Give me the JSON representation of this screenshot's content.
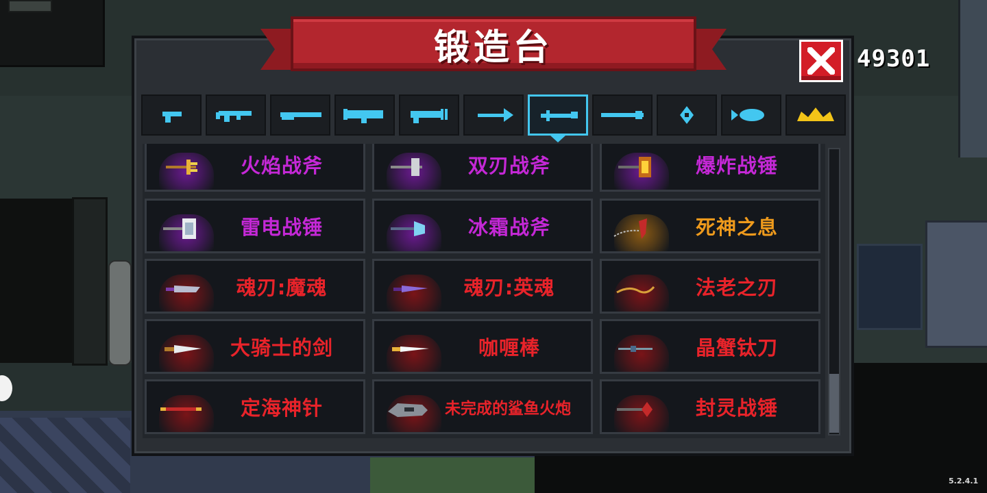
{
  "hud": {
    "score": "49301",
    "version": "5.2.4.1"
  },
  "forge": {
    "title": "锻造台",
    "close_icon": "close-x-icon",
    "tabs": [
      {
        "icon": "pistol-icon",
        "selected": false
      },
      {
        "icon": "rifle-icon",
        "selected": false
      },
      {
        "icon": "shotgun-icon",
        "selected": false
      },
      {
        "icon": "launcher-icon",
        "selected": false
      },
      {
        "icon": "laser-icon",
        "selected": false
      },
      {
        "icon": "bow-icon",
        "selected": false
      },
      {
        "icon": "melee-icon",
        "selected": true
      },
      {
        "icon": "spear-icon",
        "selected": false
      },
      {
        "icon": "throwing-star-icon",
        "selected": false
      },
      {
        "icon": "fish-icon",
        "selected": false
      },
      {
        "icon": "crown-icon",
        "selected": false
      }
    ],
    "weapons": [
      {
        "name": "火焰战斧",
        "rarity": "purple",
        "color": "#c428d6"
      },
      {
        "name": "双刃战斧",
        "rarity": "purple",
        "color": "#c428d6"
      },
      {
        "name": "爆炸战锤",
        "rarity": "purple",
        "color": "#c428d6"
      },
      {
        "name": "雷电战锤",
        "rarity": "purple",
        "color": "#c428d6"
      },
      {
        "name": "冰霜战斧",
        "rarity": "purple",
        "color": "#c428d6"
      },
      {
        "name": "死神之息",
        "rarity": "orange",
        "color": "#ee9a1c"
      },
      {
        "name": "魂刃:魔魂",
        "rarity": "red",
        "color": "#e8232a"
      },
      {
        "name": "魂刃:英魂",
        "rarity": "red",
        "color": "#e8232a"
      },
      {
        "name": "法老之刃",
        "rarity": "red",
        "color": "#e8232a"
      },
      {
        "name": "大骑士的剑",
        "rarity": "red",
        "color": "#e8232a"
      },
      {
        "name": "咖喱棒",
        "rarity": "red",
        "color": "#e8232a"
      },
      {
        "name": "晶蟹钛刀",
        "rarity": "red",
        "color": "#e8232a"
      },
      {
        "name": "定海神针",
        "rarity": "red",
        "color": "#e8232a"
      },
      {
        "name": "未完成的鲨鱼火炮",
        "rarity": "red",
        "color": "#e8232a"
      },
      {
        "name": "封灵战锤",
        "rarity": "red",
        "color": "#e8232a"
      }
    ]
  },
  "colors": {
    "accent": "#43c7f0",
    "banner": "#b3262e",
    "purple_glow": "#6a1a8f",
    "orange_glow": "#8a5a14",
    "red_glow": "#7a1418"
  }
}
